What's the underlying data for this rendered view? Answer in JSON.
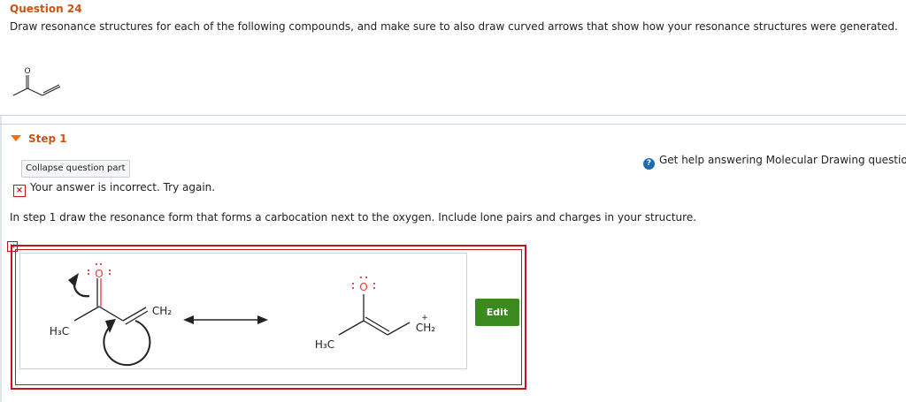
{
  "question": {
    "title": "Question 24",
    "text": "Draw resonance structures for each of the following compounds, and make sure to also draw curved arrows that show how your resonance structures were generated."
  },
  "step": {
    "label": "Step 1",
    "collapse_label": "Collapse question part",
    "help_text": "Get help answering Molecular Drawing question",
    "help_icon": "?",
    "feedback": "Your answer is incorrect.  Try again.",
    "instruction": "In step 1 draw the resonance form that forms a carbocation next to the oxygen. Include lone pairs and charges in your structure."
  },
  "drawing": {
    "left_o": "O",
    "left_h3c": "H₃C",
    "left_ch2": "CH₂",
    "right_o": "O",
    "right_h3c": "H₃C",
    "right_ch2": "CH₂",
    "plus": "+",
    "edit_label": "Edit"
  },
  "colors": {
    "accent": "#c75512",
    "error": "#c0171d",
    "edit_button": "#3a8a20",
    "help_icon": "#1c6bb3",
    "oxygen": "#e53935"
  }
}
